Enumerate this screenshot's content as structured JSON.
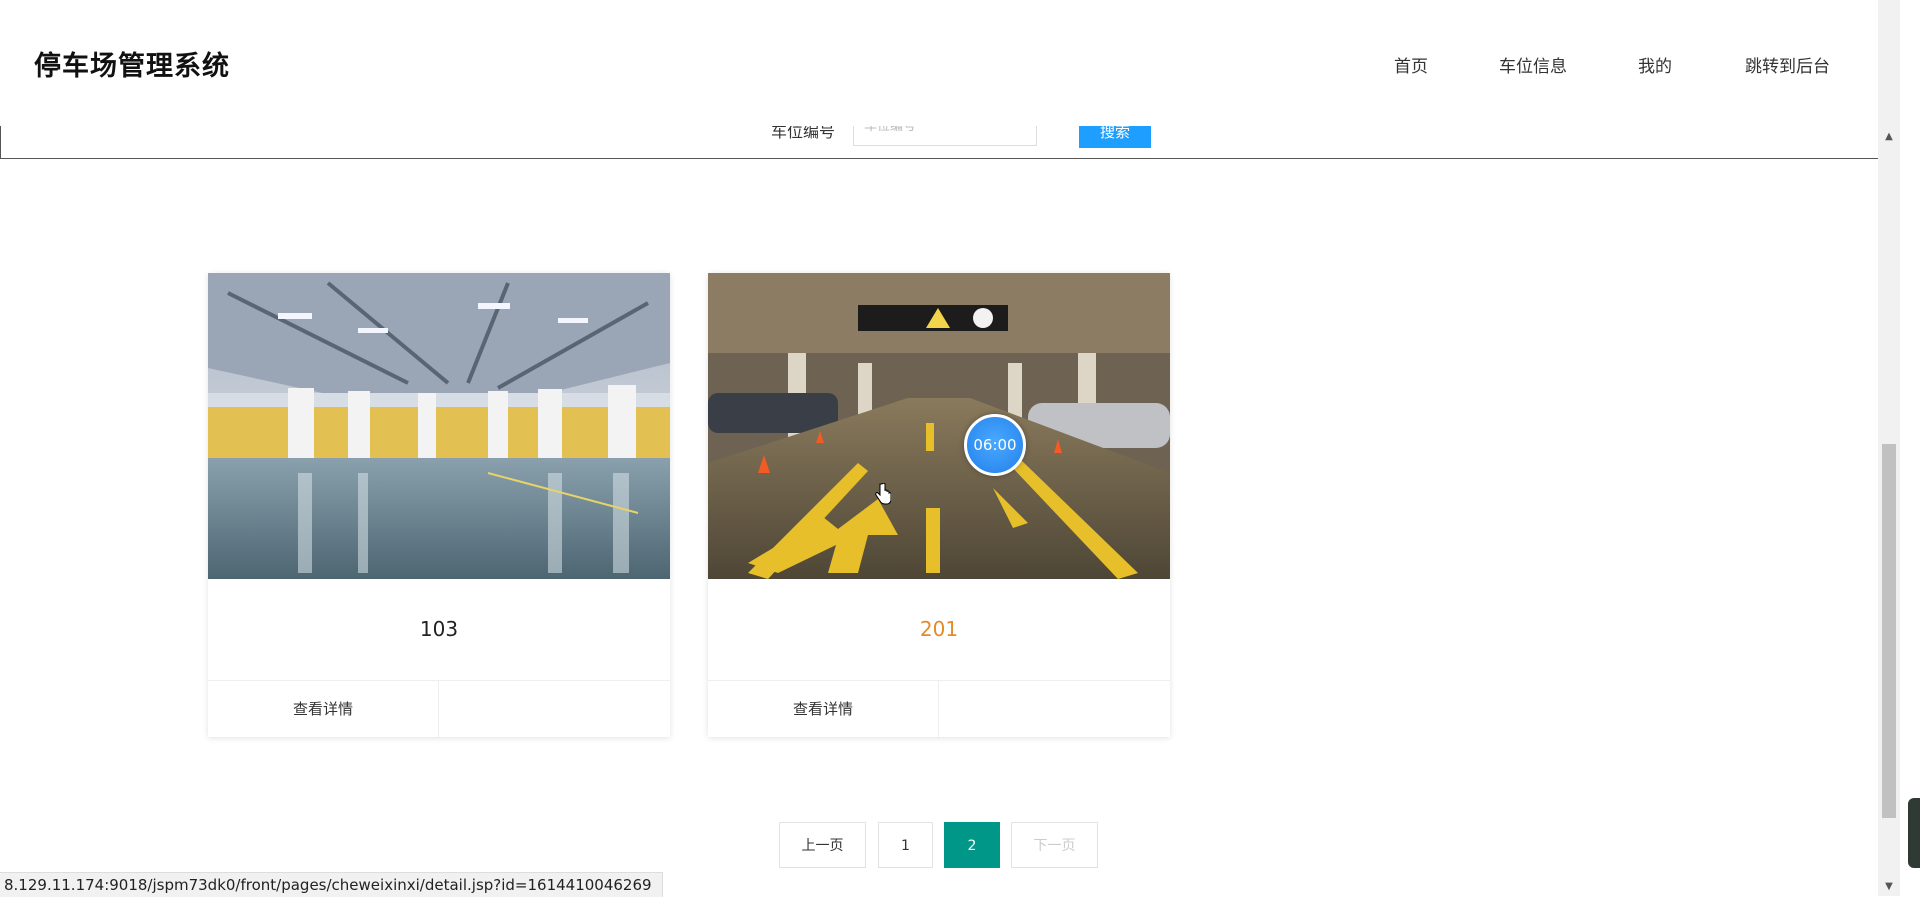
{
  "header": {
    "title": "停车场管理系统",
    "nav": [
      "首页",
      "车位信息",
      "我的",
      "跳转到后台"
    ]
  },
  "search": {
    "label": "车位编号",
    "placeholder": "车位编号",
    "button_label": "搜索"
  },
  "cards": [
    {
      "number": "103",
      "detail_label": "查看详情"
    },
    {
      "number": "201",
      "detail_label": "查看详情"
    }
  ],
  "timer": {
    "text": "06:00"
  },
  "pagination": {
    "prev_label": "上一页",
    "pages": [
      "1",
      "2"
    ],
    "current_page": "2",
    "next_label": "下一页"
  },
  "status_bar": {
    "url": "8.129.11.174:9018/jspm73dk0/front/pages/cheweixinxi/detail.jsp?id=1614410046269"
  },
  "colors": {
    "primary_button": "#1e9fff",
    "active_page": "#009688",
    "hover_title": "#e58a2b"
  }
}
